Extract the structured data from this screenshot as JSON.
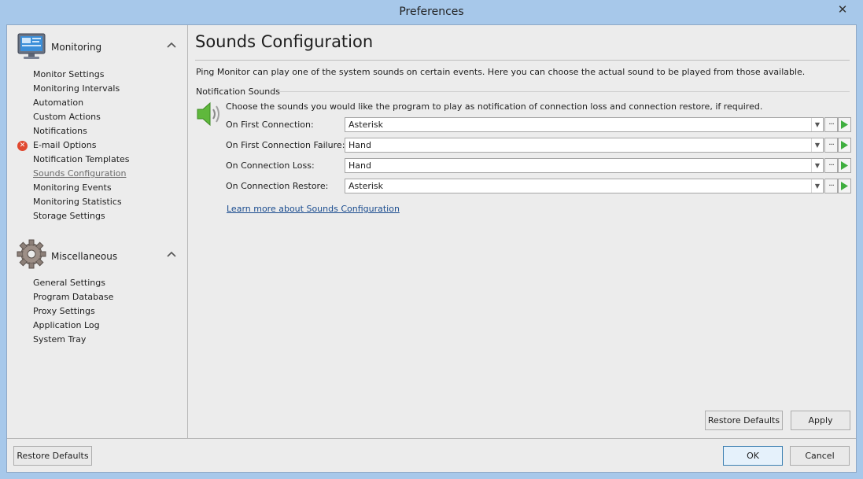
{
  "window": {
    "title": "Preferences",
    "close_glyph": "✕"
  },
  "nav": {
    "groups": [
      {
        "title": "Monitoring",
        "icon": "monitor-icon",
        "items": [
          "Monitor Settings",
          "Monitoring Intervals",
          "Automation",
          "Custom Actions",
          "Notifications",
          "E-mail Options",
          "Notification Templates",
          "Sounds Configuration",
          "Monitoring Events",
          "Monitoring Statistics",
          "Storage Settings"
        ],
        "error_item": "E-mail Options",
        "selected_item": "Sounds Configuration"
      },
      {
        "title": "Miscellaneous",
        "icon": "gear-icon",
        "items": [
          "General Settings",
          "Program Database",
          "Proxy Settings",
          "Application Log",
          "System Tray"
        ]
      }
    ]
  },
  "content": {
    "title": "Sounds Configuration",
    "intro": "Ping Monitor can play one of the system sounds on certain events. Here you can choose the actual sound to be played from those available.",
    "section_label": "Notification Sounds",
    "section_desc": "Choose the sounds you would like the program to play as notification of connection loss and connection restore, if required.",
    "rows": [
      {
        "label": "On First Connection:",
        "value": "Asterisk"
      },
      {
        "label": "On First Connection Failure:",
        "value": "Hand"
      },
      {
        "label": "On Connection Loss:",
        "value": "Hand"
      },
      {
        "label": "On Connection Restore:",
        "value": "Asterisk"
      }
    ],
    "more_glyph": "···",
    "link": "Learn more about Sounds Configuration",
    "restore_defaults": "Restore Defaults",
    "apply": "Apply"
  },
  "footer": {
    "restore_defaults": "Restore Defaults",
    "ok": "OK",
    "cancel": "Cancel"
  },
  "colors": {
    "accent": "#3c7fb1",
    "play_green": "#3fae3f",
    "error_red": "#e0482f",
    "link": "#1a4c8f"
  }
}
